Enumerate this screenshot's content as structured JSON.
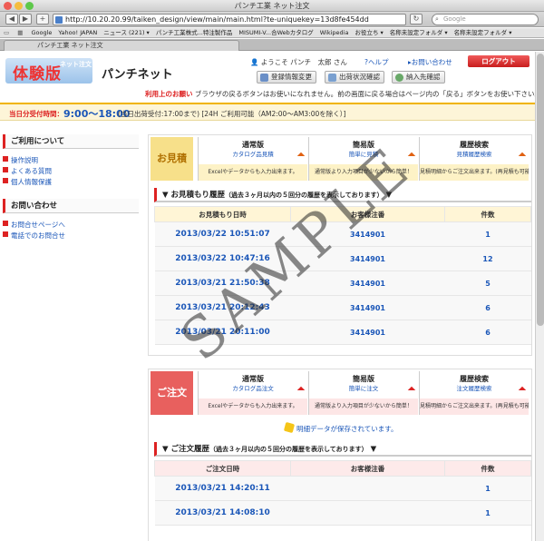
{
  "browser": {
    "window_title": "パンチ工業 ネット注文",
    "url": "http://10.20.20.99/taiken_design/view/main/main.html?te-uniquekey=13d8fe454dd",
    "search_placeholder": "Google",
    "bookmarks": [
      "Google",
      "Yahoo! JAPAN",
      "ニュース (221) ▾",
      "パンチ工業株式...特注製作品",
      "MISUMI-V...合Webカタログ",
      "Wikipedia",
      "お役立ち ▾",
      "名称未設定フォルダ ▾",
      "名称未設定フォルダ ▾"
    ],
    "tab_label": "パンチ工業 ネット注文"
  },
  "header": {
    "logo_text": "体験版",
    "logo_sub": "ネット注文",
    "brand": "パンチネット",
    "welcome": "ようこそ パンチ　太郎 さん",
    "help": "ヘルプ",
    "contact": "お問い合わせ",
    "logout": "ログアウト",
    "buttons": [
      "登録情報変更",
      "出荷状況確認",
      "納入先確認"
    ]
  },
  "notice": {
    "label": "利用上のお願い",
    "text": "ブラウザの戻るボタンはお使いになれません。前の画面に戻る場合はページ内の「戻る」ボタンをお使い下さい。"
  },
  "hours": {
    "label": "当日分受付時間：",
    "time": "9:00〜18:00",
    "note": "(当日出荷受付:17:00まで) [24H ご利用可能（AM2:00〜AM3:00を除く）]"
  },
  "sidebar": {
    "section1": "ご利用について",
    "links1": [
      "操作説明",
      "よくある質問",
      "個人情報保護"
    ],
    "section2": "お問い合わせ",
    "links2": [
      "お問合せページへ",
      "電話でのお問合せ"
    ]
  },
  "quote": {
    "tag": "お見積",
    "options": [
      {
        "title": "通常版",
        "sub": "カタログ品見積",
        "desc": "Excelやデータからも入力出来ます。"
      },
      {
        "title": "簡易版",
        "sub": "簡単に見積",
        "desc": "通常版より入力項目が少ないから簡単！"
      },
      {
        "title": "履歴検索",
        "sub": "見積履歴検索",
        "desc": "見積明細からご注文出来ます。(再見積も可能)"
      }
    ],
    "history_title": "お見積もり履歴",
    "history_note": "（過去３ヶ月以内の５回分の履歴を表示しております）",
    "columns": [
      "お見積もり日時",
      "お客様注番",
      "件数"
    ],
    "rows": [
      {
        "date": "2013/03/22 10:51:07",
        "number": "3414901",
        "count": "1"
      },
      {
        "date": "2013/03/22 10:47:16",
        "number": "3414901",
        "count": "12"
      },
      {
        "date": "2013/03/21 21:50:38",
        "number": "3414901",
        "count": "5"
      },
      {
        "date": "2013/03/21 20:12:43",
        "number": "3414901",
        "count": "6"
      },
      {
        "date": "2013/03/21 20:11:00",
        "number": "3414901",
        "count": "6"
      }
    ]
  },
  "order": {
    "tag": "ご注文",
    "options": [
      {
        "title": "通常版",
        "sub": "カタログ品注文",
        "desc": "Excelやデータからも入力出来ます。"
      },
      {
        "title": "簡易版",
        "sub": "簡単に注文",
        "desc": "通常版より入力項目が少ないから簡単！"
      },
      {
        "title": "履歴検索",
        "sub": "注文履歴検索",
        "desc": "見積明細からご注文出来ます。(再見積も可能)"
      }
    ],
    "saved_message": "明細データが保存されています。",
    "history_title": "ご注文履歴",
    "history_note": "（過去３ヶ月以内の５回分の履歴を表示しております）",
    "columns": [
      "ご注文日時",
      "お客様注番",
      "件数"
    ],
    "rows": [
      {
        "date": "2013/03/21 14:20:11",
        "number": "",
        "count": "1"
      },
      {
        "date": "2013/03/21 14:08:10",
        "number": "",
        "count": "1"
      }
    ]
  },
  "watermark": "SAMPLE",
  "colors": {
    "accent_red": "#dd2222",
    "link_blue": "#1a56b8",
    "quote_yellow": "#f7e08a",
    "order_red": "#e8605e"
  }
}
